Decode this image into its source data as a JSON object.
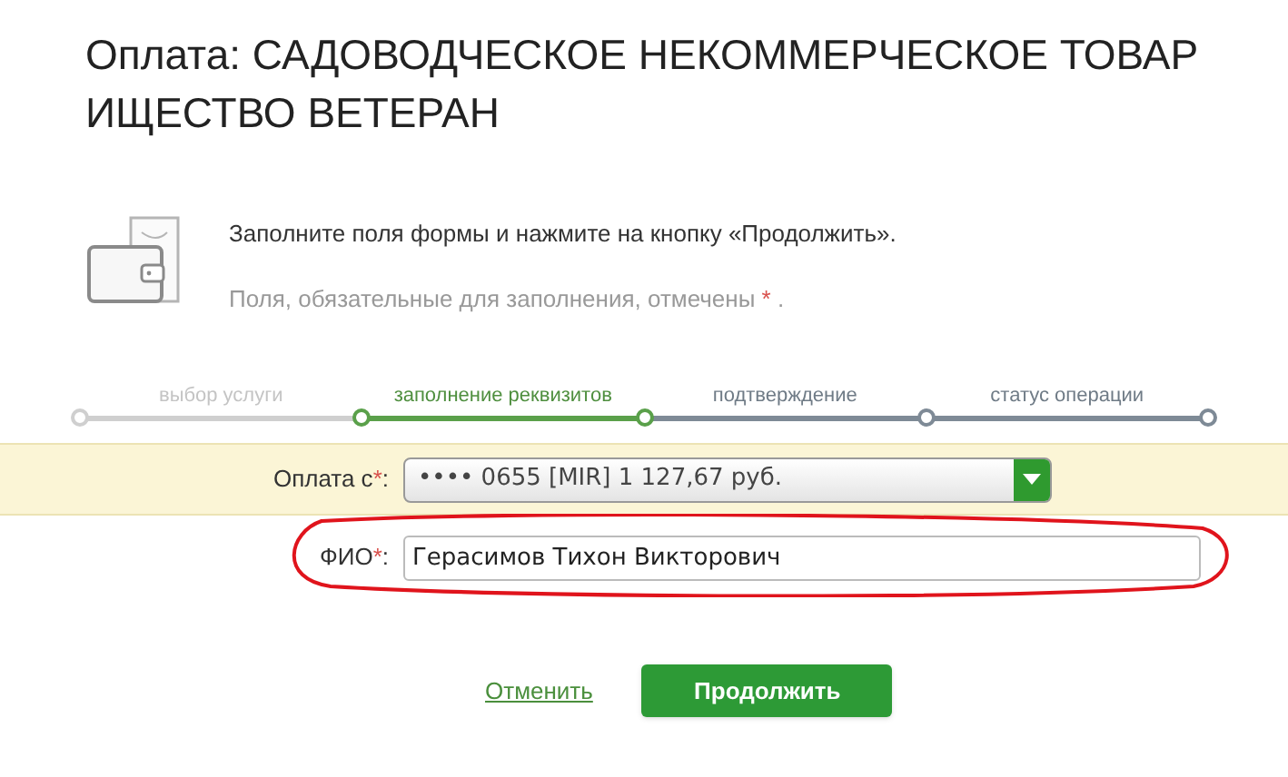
{
  "title": "Оплата: САДОВОДЧЕСКОЕ НЕКОММЕРЧЕСКОЕ ТОВАР ИЩЕСТВО ВЕТЕРАН",
  "intro": {
    "instruction": "Заполните поля формы и нажмите на кнопку «Продолжить».",
    "note": "Поля, обязательные для заполнения, отмечены",
    "note_mark": "*",
    "note_end": "."
  },
  "steps": [
    {
      "label": "выбор услуги",
      "selected": false,
      "completed": true
    },
    {
      "label": "заполнение реквизитов",
      "selected": true,
      "completed": false
    },
    {
      "label": "подтверждение",
      "selected": false,
      "completed": false
    },
    {
      "label": "статус операции",
      "selected": false,
      "completed": false
    }
  ],
  "payment_from": {
    "label": "Оплата с",
    "mark": "*",
    "colon": ":",
    "value": "•••• 0655 [MIR] 1 127,67 руб."
  },
  "full_name": {
    "label": "ФИО",
    "mark": "*",
    "colon": ":",
    "value": "Герасимов Тихон Викторович",
    "circled": true
  },
  "cancel": "Отменить",
  "continue": "Продолжить"
}
